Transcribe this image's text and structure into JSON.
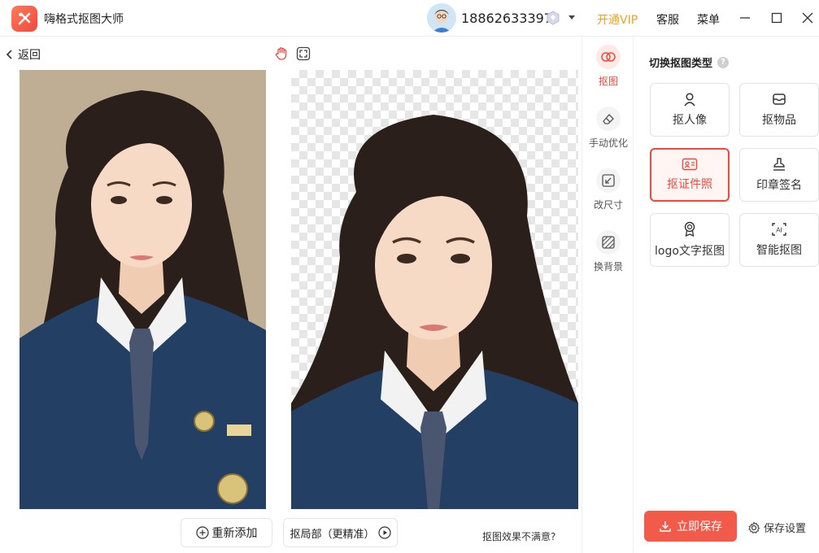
{
  "app": {
    "title": "嗨格式抠图大师"
  },
  "header": {
    "phone": "18862633397",
    "vip_label": "开通VIP",
    "service_label": "客服",
    "menu_label": "菜单"
  },
  "toolbar": {
    "back_label": "返回"
  },
  "bottom": {
    "readd_label": "重新添加",
    "local_cut_label": "抠局部（更精准）",
    "unsatisfied_label": "抠图效果不满意?"
  },
  "tools": [
    {
      "label": "抠图",
      "icon": "cutout-icon",
      "active": true
    },
    {
      "label": "手动优化",
      "icon": "eraser-icon",
      "active": false
    },
    {
      "label": "改尺寸",
      "icon": "resize-icon",
      "active": false
    },
    {
      "label": "换背景",
      "icon": "background-icon",
      "active": false
    }
  ],
  "panel": {
    "title": "切换抠图类型",
    "types": [
      {
        "label": "抠人像",
        "icon": "person-icon",
        "active": false
      },
      {
        "label": "抠物品",
        "icon": "inbox-icon",
        "active": false
      },
      {
        "label": "抠证件照",
        "icon": "id-card-icon",
        "active": true
      },
      {
        "label": "印章签名",
        "icon": "stamp-icon",
        "active": false
      },
      {
        "label": "logo文字抠图",
        "icon": "award-icon",
        "active": false
      },
      {
        "label": "智能抠图",
        "icon": "ai-icon",
        "active": false
      }
    ],
    "save_label": "立即保存",
    "save_settings_label": "保存设置"
  },
  "colors": {
    "accent": "#f04a3c",
    "vip": "#f0a020",
    "save": "#f25b4a"
  }
}
